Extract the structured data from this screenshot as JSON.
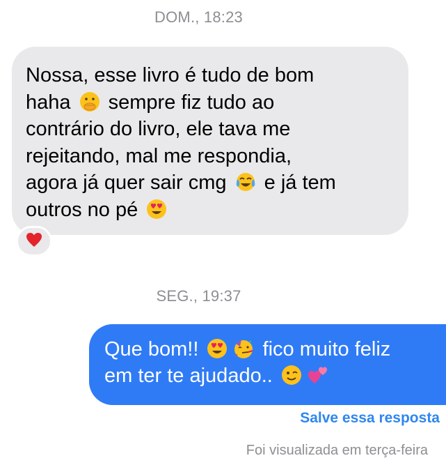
{
  "thread": {
    "timestamp_1": "DOM., 18:23",
    "timestamp_2": "SEG., 19:37"
  },
  "incoming_message": {
    "line_1": "Nossa, esse livro é tudo de bom",
    "line_2a": "haha",
    "line_2b": "sempre fiz tudo ao",
    "line_3": "contrário do livro, ele tava me",
    "line_4": "rejeitando, mal me respondia,",
    "line_5a": "agora já quer sair cmg",
    "line_5b": "e já tem",
    "line_6": "outros no pé",
    "emojis": [
      "hand-over-mouth-emoji",
      "tears-of-joy-emoji",
      "heart-eyes-emoji"
    ],
    "reaction": "red-heart-icon"
  },
  "outgoing_message": {
    "line_1a": "Que bom!!",
    "line_1b": "fico muito feliz",
    "line_2": "em ter te ajudado..",
    "emojis": [
      "heart-eyes-emoji",
      "partying-face-emoji",
      "winking-face-emoji",
      "two-hearts-emoji"
    ]
  },
  "actions": {
    "save_reply": "Salve essa resposta"
  },
  "status": {
    "seen": "Foi visualizada em terça-feira"
  },
  "colors": {
    "outgoing_bubble": "#2f7bf6",
    "incoming_bubble": "#e9e9eb",
    "link": "#2f86f0",
    "muted_text": "#8e8e93"
  }
}
